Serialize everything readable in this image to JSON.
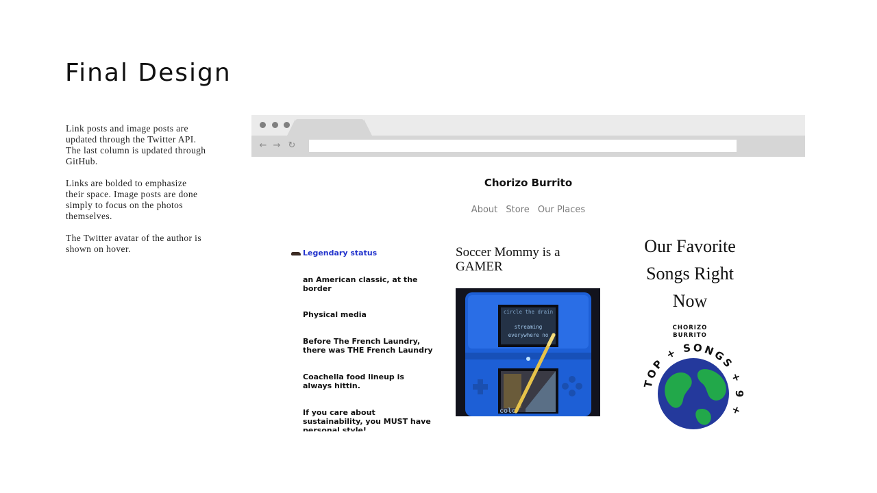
{
  "slide": {
    "title": "Final Design",
    "description": [
      "Link posts and image posts are updated through the Twitter API. The last column is updated through GitHub.",
      "Links are bolded to emphasize their space. Image posts are done simply to focus on the photos themselves.",
      "The Twitter avatar of the author is shown on hover."
    ]
  },
  "browser": {
    "window_dots": [
      "close",
      "minimize",
      "maximize"
    ],
    "nav_icons": [
      "back-arrow-icon",
      "forward-arrow-icon",
      "reload-icon"
    ],
    "address": ""
  },
  "site": {
    "title": "Chorizo Burrito",
    "nav": [
      "About",
      "Store",
      "Our Places"
    ],
    "links_column": {
      "lead": {
        "icon": "shoe-icon",
        "label": "Legendary status",
        "color": "#2233cc"
      },
      "items": [
        "an American classic, at the border",
        "Physical media",
        "Before The French Laundry, there was THE French Laundry",
        "Coachella food lineup is always hittin.",
        "If you care about sustainability, you MUST have personal style!"
      ]
    },
    "image_post": {
      "title": "Soccer Mommy is a GAMER",
      "screen_text": [
        "circle the drain",
        "streaming",
        "everywhere no"
      ],
      "device_color": "#1d5fd6"
    },
    "songs_column": {
      "title": "Our Favorite Songs Right Now",
      "brand": [
        "CHORIZO",
        "BURRITO"
      ],
      "badge_text": "TOP + SONGS + 9 +"
    }
  }
}
